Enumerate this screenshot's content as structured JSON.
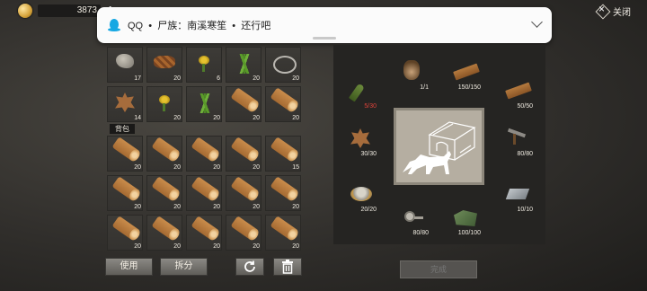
{
  "header": {
    "currency_value": "3873",
    "plus_label": "+",
    "close_label": "关闭"
  },
  "notification": {
    "text": "QQ  •  尸族：南溪寒笙  •  还行吧"
  },
  "storage": {
    "items": [
      {
        "icon": "stone",
        "qty": "17"
      },
      {
        "icon": "rope",
        "qty": "20"
      },
      {
        "icon": "flower",
        "qty": "6"
      },
      {
        "icon": "grass",
        "qty": "20"
      },
      {
        "icon": "wire",
        "qty": "20"
      },
      {
        "icon": "hide",
        "qty": "14"
      },
      {
        "icon": "flower",
        "qty": "20"
      },
      {
        "icon": "grass",
        "qty": "20"
      },
      {
        "icon": "log",
        "qty": "20"
      },
      {
        "icon": "log",
        "qty": "20"
      }
    ]
  },
  "backpack": {
    "label": "背包",
    "items": [
      {
        "icon": "log",
        "qty": "20"
      },
      {
        "icon": "log",
        "qty": "20"
      },
      {
        "icon": "log",
        "qty": "20"
      },
      {
        "icon": "log",
        "qty": "20"
      },
      {
        "icon": "log",
        "qty": "15"
      },
      {
        "icon": "log",
        "qty": "20"
      },
      {
        "icon": "log",
        "qty": "20"
      },
      {
        "icon": "log",
        "qty": "20"
      },
      {
        "icon": "log",
        "qty": "20"
      },
      {
        "icon": "log",
        "qty": "20"
      },
      {
        "icon": "log",
        "qty": "20"
      },
      {
        "icon": "log",
        "qty": "20"
      },
      {
        "icon": "log",
        "qty": "20"
      },
      {
        "icon": "log",
        "qty": "20"
      },
      {
        "icon": "log",
        "qty": "20"
      }
    ]
  },
  "buttons": {
    "use": "使用",
    "split": "拆分",
    "refresh_icon": "refresh-icon",
    "trash_icon": "trash-icon"
  },
  "recipe": {
    "slots": [
      {
        "icon": "bullet",
        "qty": "5/30",
        "short": true
      },
      {
        "icon": "dog",
        "qty": "1/1",
        "short": false
      },
      {
        "icon": "plank",
        "qty": "150/150",
        "short": false
      },
      {
        "icon": "plank",
        "qty": "50/50",
        "short": false
      },
      {
        "icon": "hide",
        "qty": "30/30",
        "short": false
      },
      {
        "icon": "hammer",
        "qty": "80/80",
        "short": false
      },
      {
        "icon": "can",
        "qty": "20/20",
        "short": false
      },
      {
        "icon": "plate",
        "qty": "10/10",
        "short": false
      },
      {
        "icon": "bolt",
        "qty": "80/80",
        "short": false
      },
      {
        "icon": "cloth",
        "qty": "100/100",
        "short": false
      }
    ],
    "result_icon": "dog-kennel-icon",
    "done_label": "完成"
  },
  "colors": {
    "insufficient": "#e0433b",
    "qq_blue": "#17a8e3"
  }
}
